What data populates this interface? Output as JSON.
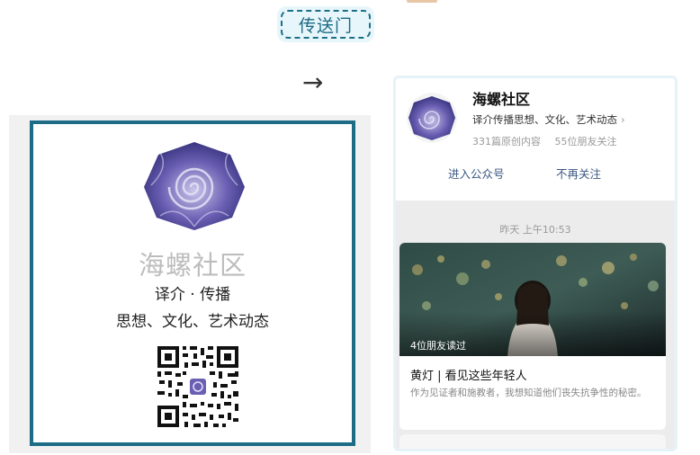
{
  "badge": {
    "label": "传送门"
  },
  "arrow": {
    "glyph": "→"
  },
  "left_card": {
    "title": "海螺社区",
    "tagline": "译介 · 传播",
    "subtitle": "思想、文化、艺术动态",
    "logo_icon": "spiral-shell-logo",
    "qr_icon": "qr-code",
    "border_color": "#1e6b86"
  },
  "account": {
    "name": "海螺社区",
    "description": "译介传播思想、文化、艺术动态",
    "chevron": "›",
    "original_count": "331篇原创内容",
    "friends_following": "55位朋友关注",
    "enter_button": "进入公众号",
    "unfollow_button": "不再关注"
  },
  "feed": {
    "timestamp": "昨天 上午10:53",
    "article": {
      "friends_read": "4位朋友读过",
      "title": "黄灯 | 看见这些年轻人",
      "description": "作为见证者和施教者，我想知道他们丧失抗争性的秘密。"
    }
  }
}
